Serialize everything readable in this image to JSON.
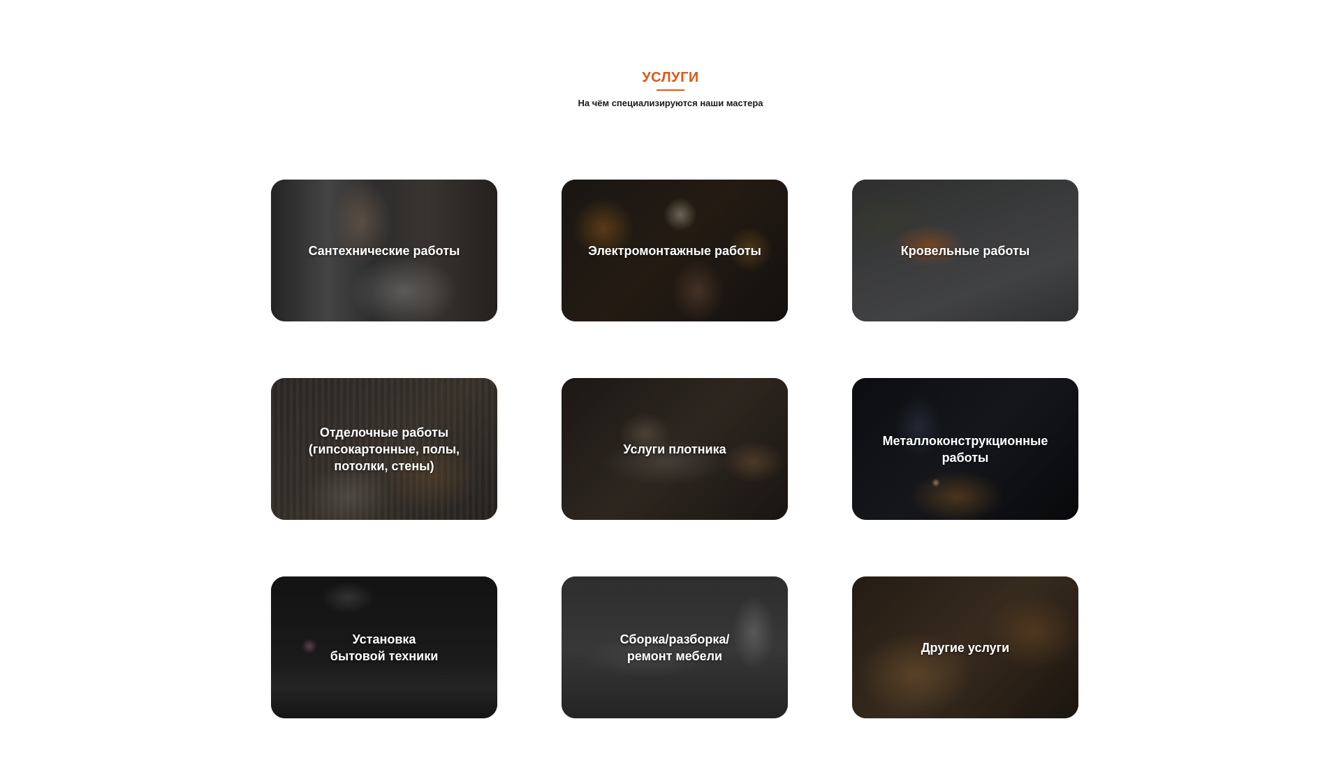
{
  "header": {
    "title": "УСЛУГИ",
    "subtitle": "На чём специализируются наши мастера"
  },
  "colors": {
    "accent": "#e8540f"
  },
  "services": [
    {
      "label": "Сантехнические работы"
    },
    {
      "label": "Электромонтажные работы"
    },
    {
      "label": "Кровельные работы"
    },
    {
      "label": "Отделочные работы\n(гипсокартонные, полы,\nпотолки, стены)"
    },
    {
      "label": "Услуги плотника"
    },
    {
      "label": "Металлоконструкционные\nработы"
    },
    {
      "label": "Установка\nбытовой техники"
    },
    {
      "label": "Сборка/разборка/\nремонт мебели"
    },
    {
      "label": "Другие услуги"
    }
  ]
}
